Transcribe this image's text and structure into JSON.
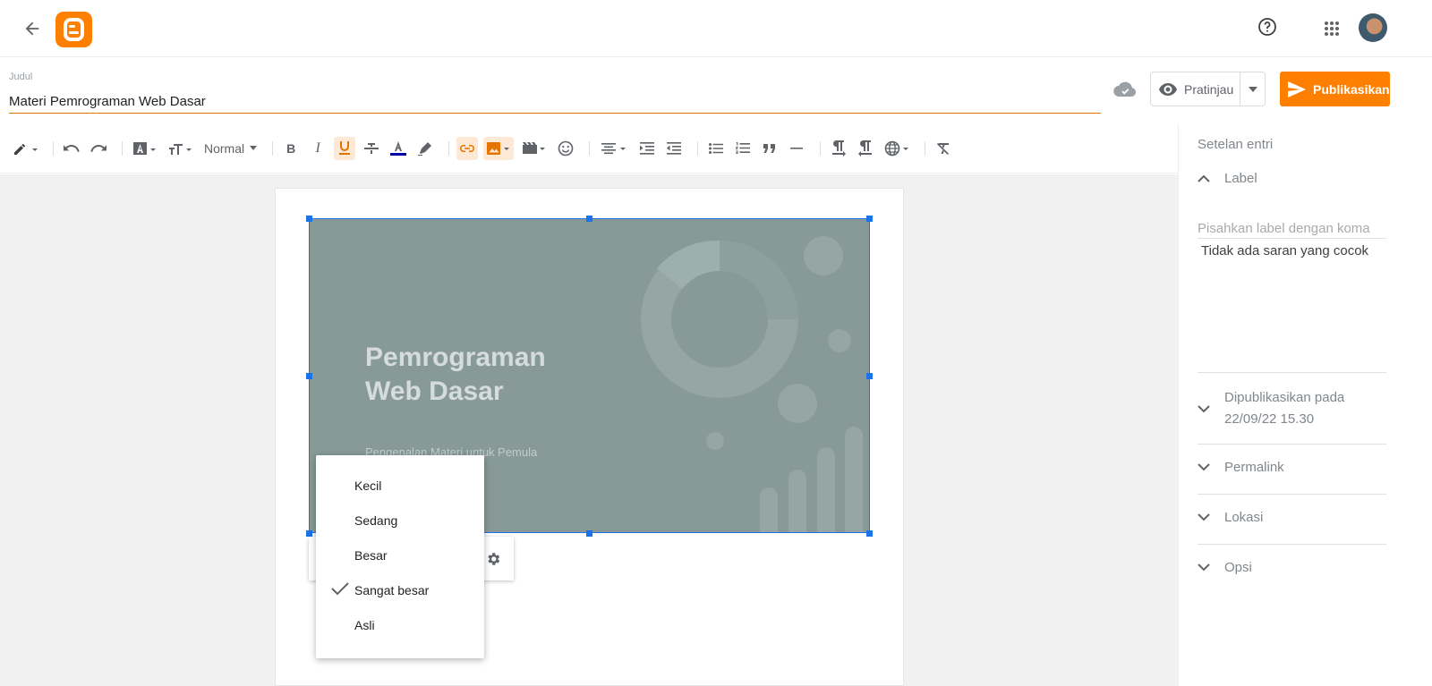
{
  "header": {
    "back_icon": "arrow-left-icon",
    "logo_icon": "blogger-logo-icon",
    "help_icon": "help-circle-icon",
    "apps_icon": "apps-grid-icon"
  },
  "title_field": {
    "label": "Judul",
    "value": "Materi Pemrograman Web Dasar"
  },
  "actions": {
    "preview_label": "Pratinjau",
    "publish_label": "Publikasikan"
  },
  "toolbar": {
    "font_size_label": "Normal"
  },
  "slide": {
    "title": "Pemrograman\nWeb Dasar",
    "subtitle": "Pengenalan Materi untuk Pemula"
  },
  "size_menu": {
    "items": [
      {
        "label": "Kecil",
        "checked": false
      },
      {
        "label": "Sedang",
        "checked": false
      },
      {
        "label": "Besar",
        "checked": false
      },
      {
        "label": "Sangat besar",
        "checked": true
      },
      {
        "label": "Asli",
        "checked": false
      }
    ]
  },
  "sidebar": {
    "title": "Setelan entri",
    "label_section": "Label",
    "label_placeholder": "Pisahkan label dengan koma",
    "no_suggestions": "Tidak ada saran yang cocok",
    "published_label": "Dipublikasikan pada",
    "published_date": "22/09/22 15.30",
    "permalink": "Permalink",
    "location": "Lokasi",
    "options": "Opsi"
  },
  "colors": {
    "accent": "#ff8000",
    "selection": "#1a73e8",
    "slide_bg": "#879a97"
  }
}
